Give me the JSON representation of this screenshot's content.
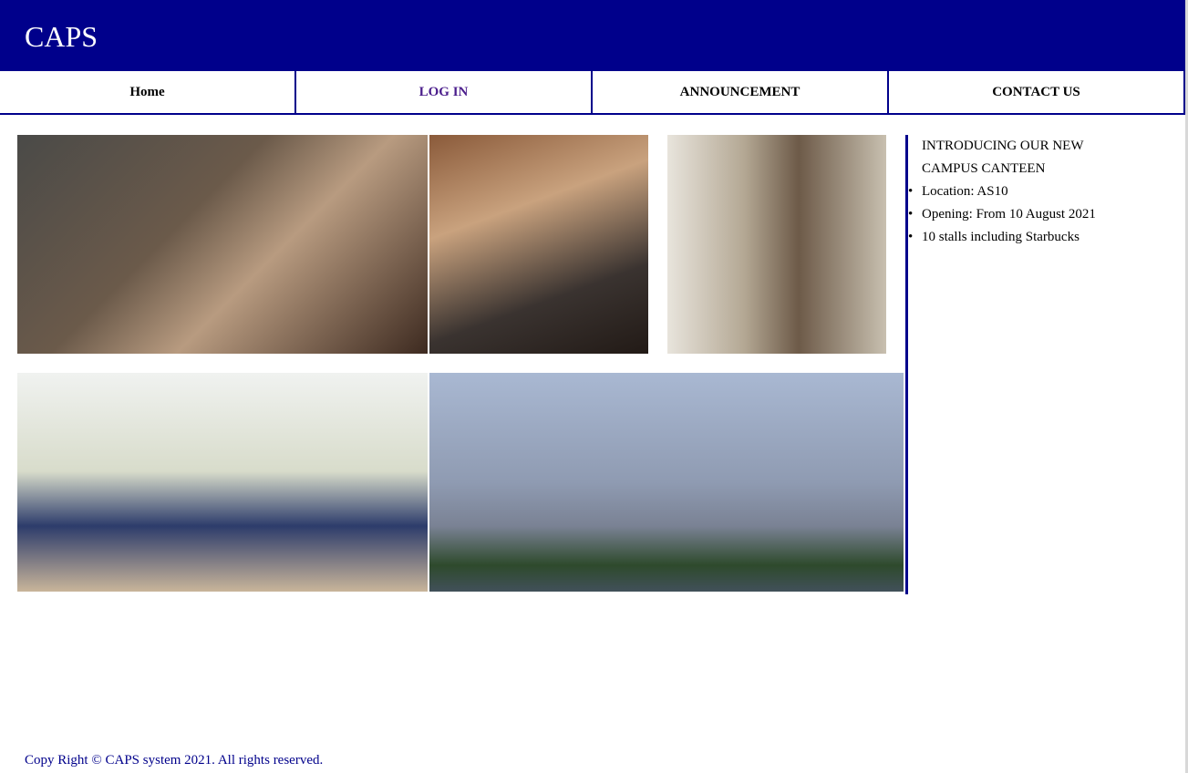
{
  "header": {
    "title": "CAPS"
  },
  "nav": [
    {
      "label": "Home"
    },
    {
      "label": "LOG IN"
    },
    {
      "label": "ANNOUNCEMENT"
    },
    {
      "label": "CONTACT US"
    }
  ],
  "announcement": {
    "title": "INTRODUCING OUR NEW CAMPUS CANTEEN",
    "items": [
      "Location: AS10",
      "Opening: From 10 August 2021",
      "10 stalls including Starbucks"
    ]
  },
  "footer": {
    "text": "Copy Right © CAPS system 2021. All rights reserved."
  }
}
